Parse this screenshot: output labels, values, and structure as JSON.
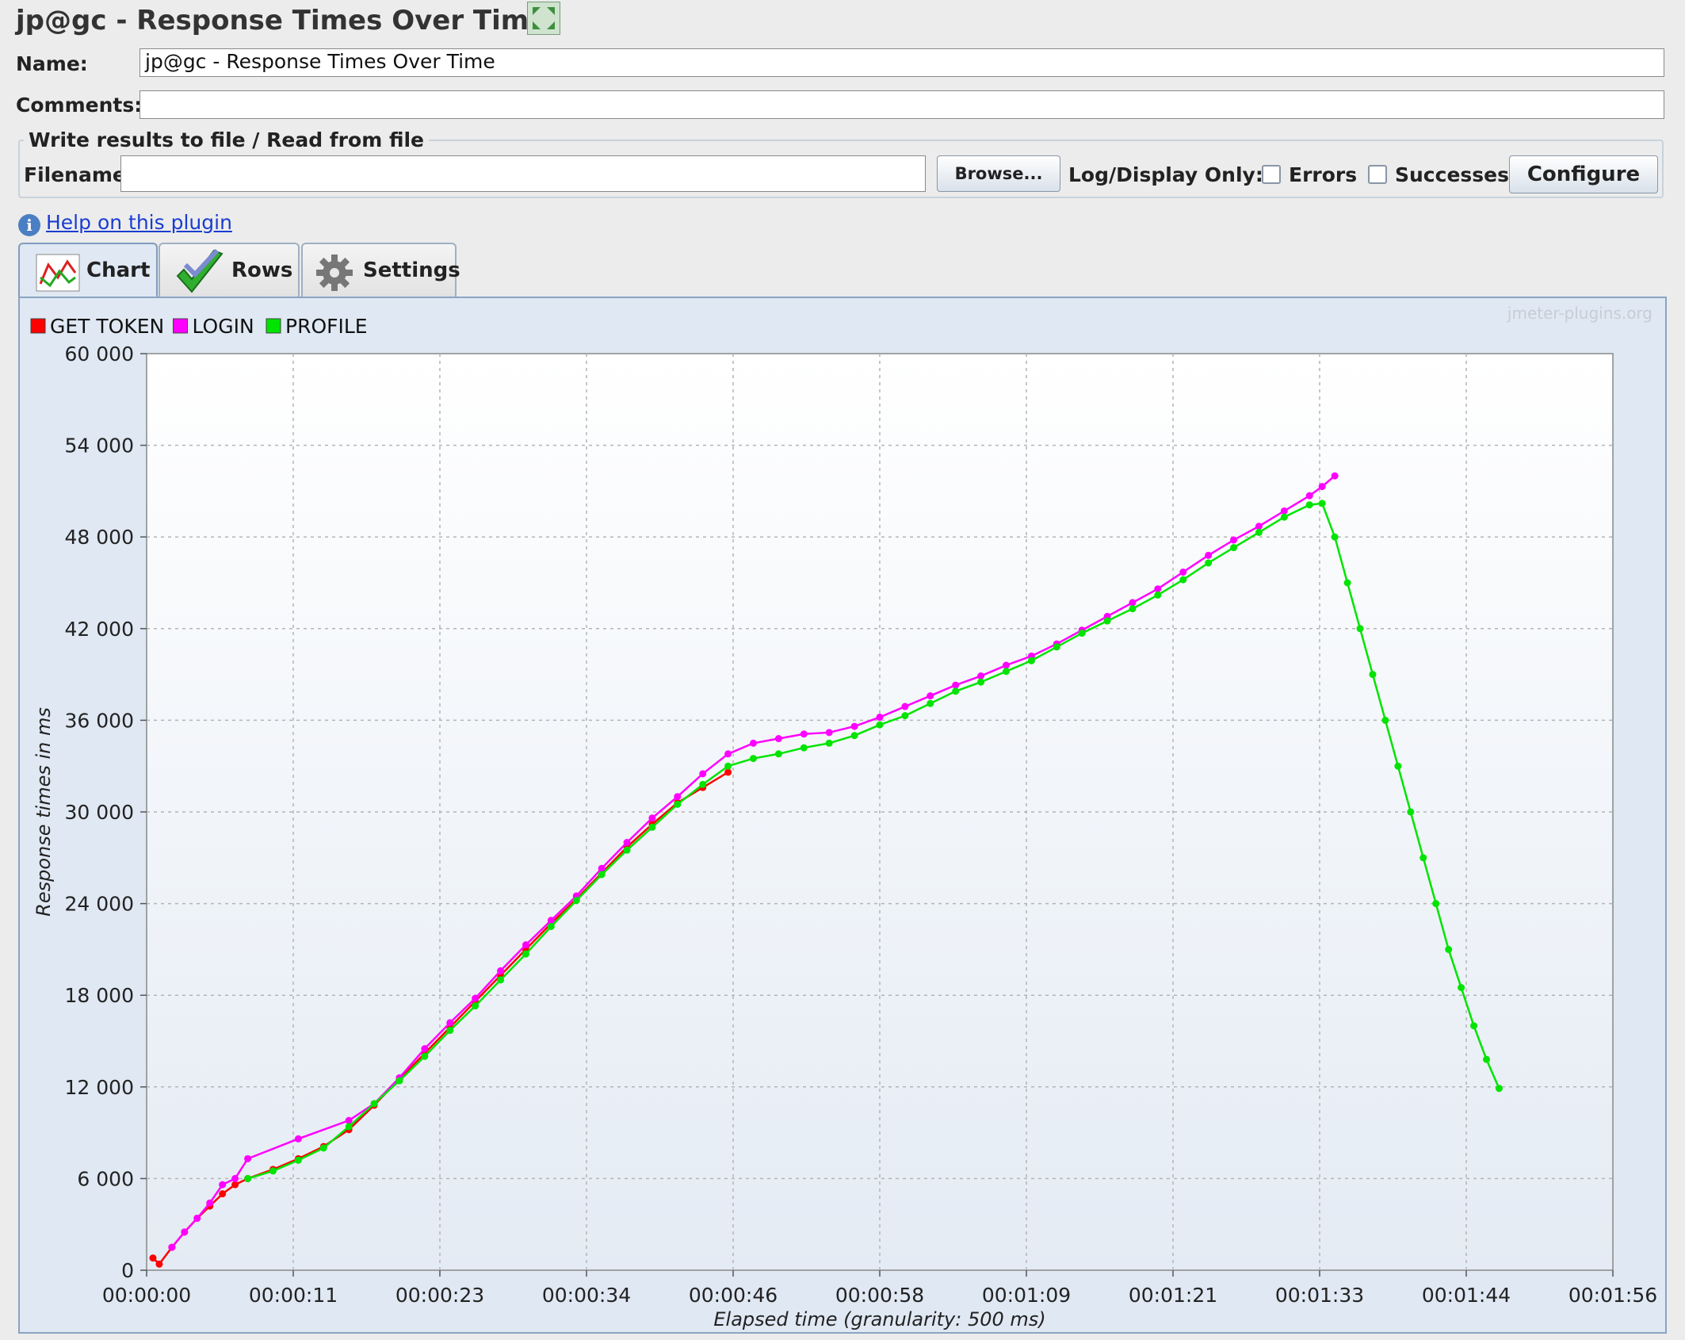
{
  "window": {
    "title": "jp@gc - Response Times Over Time"
  },
  "form": {
    "name_label": "Name:",
    "name_value": "jp@gc - Response Times Over Time",
    "comments_label": "Comments:",
    "comments_value": "",
    "file_section_label": "Write results to file / Read from file",
    "filename_label": "Filename",
    "filename_value": "",
    "browse_label": "Browse...",
    "log_display_label": "Log/Display Only:",
    "errors_label": "Errors",
    "errors_checked": false,
    "successes_label": "Successes",
    "successes_checked": false,
    "configure_label": "Configure"
  },
  "help": {
    "link_text": "Help on this plugin",
    "icon": "info-icon"
  },
  "tabs": [
    {
      "label": "Chart",
      "icon": "line-chart-icon",
      "active": true
    },
    {
      "label": "Rows",
      "icon": "checkmark-icon",
      "active": false
    },
    {
      "label": "Settings",
      "icon": "gear-icon",
      "active": false
    }
  ],
  "colors": {
    "get_token": "#ff0000",
    "login": "#ff00ff",
    "profile": "#00e400"
  },
  "chart_data": {
    "type": "line",
    "title": "",
    "watermark": "jmeter-plugins.org",
    "xlabel": "Elapsed time (granularity: 500 ms)",
    "ylabel": "Response times in ms",
    "x_unit": "seconds",
    "xlim": [
      0,
      116
    ],
    "ylim": [
      0,
      60000
    ],
    "x_tick_labels": [
      "00:00:00",
      "00:00:11",
      "00:00:23",
      "00:00:34",
      "00:00:46",
      "00:00:58",
      "00:01:09",
      "00:01:21",
      "00:01:33",
      "00:01:44",
      "00:01:56"
    ],
    "y_tick_labels": [
      "0",
      "6 000",
      "12 000",
      "18 000",
      "24 000",
      "30 000",
      "36 000",
      "42 000",
      "48 000",
      "54 000",
      "60 000"
    ],
    "grid": true,
    "legend_position": "top-left",
    "series": [
      {
        "name": "GET TOKEN",
        "color": "#ff0000",
        "points": [
          [
            0.5,
            800
          ],
          [
            1,
            400
          ],
          [
            2,
            1500
          ],
          [
            3,
            2500
          ],
          [
            4,
            3400
          ],
          [
            5,
            4200
          ],
          [
            6,
            5000
          ],
          [
            7,
            5600
          ],
          [
            8,
            6000
          ],
          [
            10,
            6600
          ],
          [
            12,
            7300
          ],
          [
            14,
            8100
          ],
          [
            16,
            9200
          ],
          [
            18,
            10800
          ],
          [
            20,
            12500
          ],
          [
            22,
            14200
          ],
          [
            24,
            15900
          ],
          [
            26,
            17600
          ],
          [
            28,
            19300
          ],
          [
            30,
            21000
          ],
          [
            32,
            22700
          ],
          [
            34,
            24300
          ],
          [
            36,
            26000
          ],
          [
            38,
            27700
          ],
          [
            40,
            29200
          ],
          [
            42,
            30600
          ],
          [
            44,
            31600
          ],
          [
            46,
            32600
          ]
        ]
      },
      {
        "name": "LOGIN",
        "color": "#ff00ff",
        "points": [
          [
            2,
            1500
          ],
          [
            3,
            2500
          ],
          [
            4,
            3400
          ],
          [
            5,
            4400
          ],
          [
            6,
            5600
          ],
          [
            7,
            6000
          ],
          [
            8,
            7300
          ],
          [
            12,
            8600
          ],
          [
            16,
            9800
          ],
          [
            18,
            10900
          ],
          [
            20,
            12600
          ],
          [
            22,
            14500
          ],
          [
            24,
            16200
          ],
          [
            26,
            17800
          ],
          [
            28,
            19600
          ],
          [
            30,
            21300
          ],
          [
            32,
            22900
          ],
          [
            34,
            24500
          ],
          [
            36,
            26300
          ],
          [
            38,
            28000
          ],
          [
            40,
            29600
          ],
          [
            42,
            31000
          ],
          [
            44,
            32500
          ],
          [
            46,
            33800
          ],
          [
            48,
            34500
          ],
          [
            50,
            34800
          ],
          [
            52,
            35100
          ],
          [
            54,
            35200
          ],
          [
            56,
            35600
          ],
          [
            58,
            36200
          ],
          [
            60,
            36900
          ],
          [
            62,
            37600
          ],
          [
            64,
            38300
          ],
          [
            66,
            38900
          ],
          [
            68,
            39600
          ],
          [
            70,
            40200
          ],
          [
            72,
            41000
          ],
          [
            74,
            41900
          ],
          [
            76,
            42800
          ],
          [
            78,
            43700
          ],
          [
            80,
            44600
          ],
          [
            82,
            45700
          ],
          [
            84,
            46800
          ],
          [
            86,
            47800
          ],
          [
            88,
            48700
          ],
          [
            90,
            49700
          ],
          [
            92,
            50700
          ],
          [
            93,
            51300
          ],
          [
            94,
            52000
          ]
        ]
      },
      {
        "name": "PROFILE",
        "color": "#00e400",
        "points": [
          [
            8,
            6000
          ],
          [
            10,
            6500
          ],
          [
            12,
            7200
          ],
          [
            14,
            8000
          ],
          [
            16,
            9400
          ],
          [
            18,
            10900
          ],
          [
            20,
            12400
          ],
          [
            22,
            14000
          ],
          [
            24,
            15700
          ],
          [
            26,
            17300
          ],
          [
            28,
            19000
          ],
          [
            30,
            20700
          ],
          [
            32,
            22500
          ],
          [
            34,
            24200
          ],
          [
            36,
            25900
          ],
          [
            38,
            27500
          ],
          [
            40,
            29000
          ],
          [
            42,
            30500
          ],
          [
            44,
            31800
          ],
          [
            46,
            33000
          ],
          [
            48,
            33500
          ],
          [
            50,
            33800
          ],
          [
            52,
            34200
          ],
          [
            54,
            34500
          ],
          [
            56,
            35000
          ],
          [
            58,
            35700
          ],
          [
            60,
            36300
          ],
          [
            62,
            37100
          ],
          [
            64,
            37900
          ],
          [
            66,
            38500
          ],
          [
            68,
            39200
          ],
          [
            70,
            39900
          ],
          [
            72,
            40800
          ],
          [
            74,
            41700
          ],
          [
            76,
            42500
          ],
          [
            78,
            43300
          ],
          [
            80,
            44200
          ],
          [
            82,
            45200
          ],
          [
            84,
            46300
          ],
          [
            86,
            47300
          ],
          [
            88,
            48300
          ],
          [
            90,
            49300
          ],
          [
            92,
            50100
          ],
          [
            93,
            50200
          ],
          [
            94,
            48000
          ],
          [
            95,
            45000
          ],
          [
            96,
            42000
          ],
          [
            97,
            39000
          ],
          [
            98,
            36000
          ],
          [
            99,
            33000
          ],
          [
            100,
            30000
          ],
          [
            101,
            27000
          ],
          [
            102,
            24000
          ],
          [
            103,
            21000
          ],
          [
            104,
            18500
          ],
          [
            105,
            16000
          ],
          [
            106,
            13800
          ],
          [
            107,
            11900
          ]
        ]
      }
    ]
  }
}
